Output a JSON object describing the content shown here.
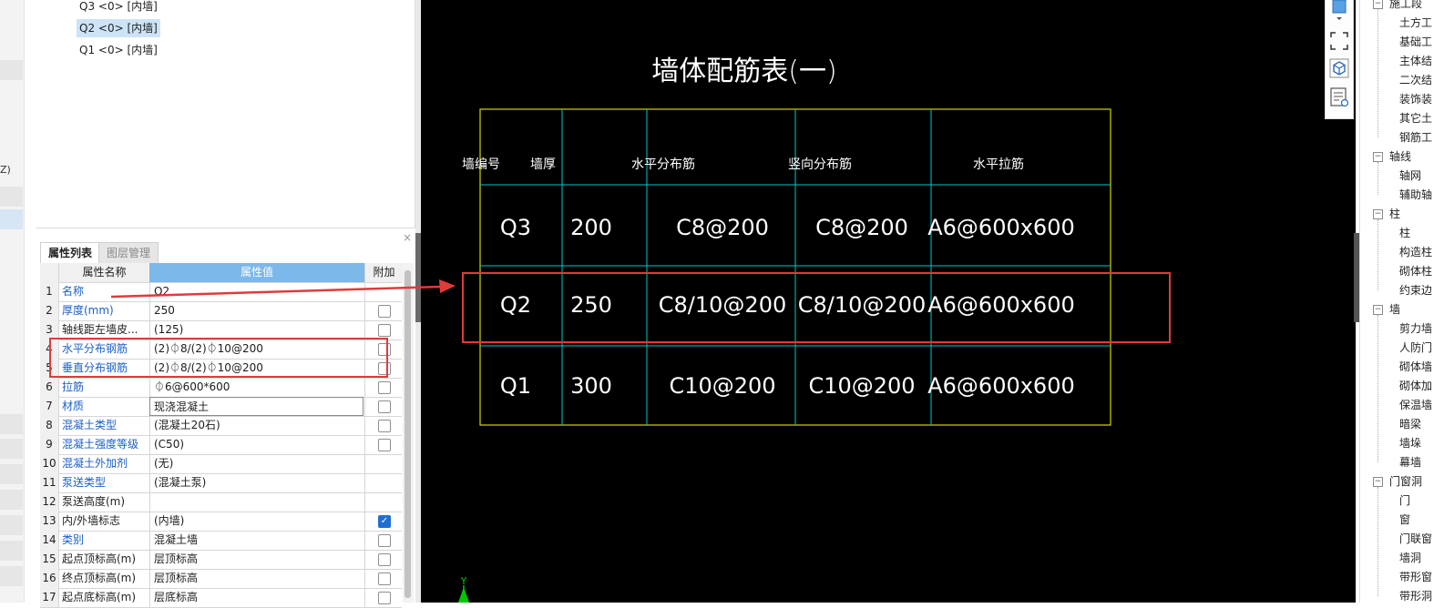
{
  "left_strip": {
    "z_label": "Z)"
  },
  "component_tree": {
    "items": [
      {
        "label": "Q3 <0> [内墙]",
        "selected": false
      },
      {
        "label": "Q2 <0> [内墙]",
        "selected": true
      },
      {
        "label": "Q1 <0> [内墙]",
        "selected": false
      }
    ]
  },
  "property_panel": {
    "close_label": "×",
    "tabs": [
      "属性列表",
      "图层管理"
    ],
    "headers": {
      "num": "",
      "name": "属性名称",
      "value": "属性值",
      "add": "附加"
    },
    "rows": [
      {
        "num": "1",
        "name": "名称",
        "value": "Q2",
        "blue": true,
        "has_check": false,
        "checked": false
      },
      {
        "num": "2",
        "name": "厚度(mm)",
        "value": "250",
        "blue": true,
        "has_check": true,
        "checked": false
      },
      {
        "num": "3",
        "name": "轴线距左墙皮...",
        "value": "(125)",
        "blue": false,
        "has_check": true,
        "checked": false
      },
      {
        "num": "4",
        "name": "水平分布钢筋",
        "value": "(2)⏀8/(2)⏀10@200",
        "blue": true,
        "has_check": true,
        "checked": false
      },
      {
        "num": "5",
        "name": "垂直分布钢筋",
        "value": "(2)⏀8/(2)⏀10@200",
        "blue": true,
        "has_check": true,
        "checked": false
      },
      {
        "num": "6",
        "name": "拉筋",
        "value": "⏀6@600*600",
        "blue": true,
        "has_check": true,
        "checked": false
      },
      {
        "num": "7",
        "name": "材质",
        "value": "现浇混凝土",
        "blue": true,
        "has_check": true,
        "checked": false,
        "editing": true
      },
      {
        "num": "8",
        "name": "混凝土类型",
        "value": "(混凝土20石)",
        "blue": true,
        "has_check": true,
        "checked": false
      },
      {
        "num": "9",
        "name": "混凝土强度等级",
        "value": "(C50)",
        "blue": true,
        "has_check": true,
        "checked": false
      },
      {
        "num": "10",
        "name": "混凝土外加剂",
        "value": "(无)",
        "blue": true,
        "has_check": false,
        "checked": false
      },
      {
        "num": "11",
        "name": "泵送类型",
        "value": "(混凝土泵)",
        "blue": true,
        "has_check": false,
        "checked": false
      },
      {
        "num": "12",
        "name": "泵送高度(m)",
        "value": "",
        "blue": false,
        "has_check": false,
        "checked": false
      },
      {
        "num": "13",
        "name": "内/外墙标志",
        "value": "(内墙)",
        "blue": false,
        "has_check": true,
        "checked": true
      },
      {
        "num": "14",
        "name": "类别",
        "value": "混凝土墙",
        "blue": true,
        "has_check": true,
        "checked": false
      },
      {
        "num": "15",
        "name": "起点顶标高(m)",
        "value": "层顶标高",
        "blue": false,
        "has_check": true,
        "checked": false
      },
      {
        "num": "16",
        "name": "终点顶标高(m)",
        "value": "层顶标高",
        "blue": false,
        "has_check": true,
        "checked": false
      },
      {
        "num": "17",
        "name": "起点底标高(m)",
        "value": "层底标高",
        "blue": false,
        "has_check": true,
        "checked": false
      }
    ]
  },
  "cad_drawing": {
    "title": "墙体配筋表(一)",
    "colors": {
      "background": "#000000",
      "outer_border": "#d4d400",
      "grid": "#00c8c8",
      "text": "#ffffff",
      "highlight": "#e03b3b",
      "arrow": "#e03b3b"
    },
    "headers": [
      "墙编号",
      "墙厚",
      "水平分布筋",
      "竖向分布筋",
      "水平拉筋"
    ],
    "rows": [
      [
        "Q3",
        "200",
        "C8@200",
        "C8@200",
        "A6@600x600"
      ],
      [
        "Q2",
        "250",
        "C8/10@200",
        "C8/10@200",
        "A6@600x600"
      ],
      [
        "Q1",
        "300",
        "C10@200",
        "C10@200",
        "A6@600x600"
      ]
    ],
    "axis_label": "Y"
  },
  "toolbar": {
    "icons": [
      "3d-cube-icon",
      "fullscreen-icon",
      "view-cube-icon",
      "list-view-icon"
    ]
  },
  "right_tree": {
    "groups": [
      {
        "label": "施工段",
        "children": [
          "土方工",
          "基础工",
          "主体结",
          "二次结",
          "装饰装",
          "其它土",
          "钢筋工"
        ]
      },
      {
        "label": "轴线",
        "children": [
          "轴网",
          "辅助轴"
        ]
      },
      {
        "label": "柱",
        "children": [
          "柱",
          "构造柱",
          "砌体柱",
          "约束边"
        ]
      },
      {
        "label": "墙",
        "children": [
          "剪力墙",
          "人防门",
          "砌体墙",
          "砌体加",
          "保温墙",
          "暗梁",
          "墙垛",
          "幕墙"
        ]
      },
      {
        "label": "门窗洞",
        "children": [
          "门",
          "窗",
          "门联窗",
          "墙洞",
          "带形窗",
          "带形洞"
        ]
      }
    ],
    "expand_symbol": "−"
  }
}
